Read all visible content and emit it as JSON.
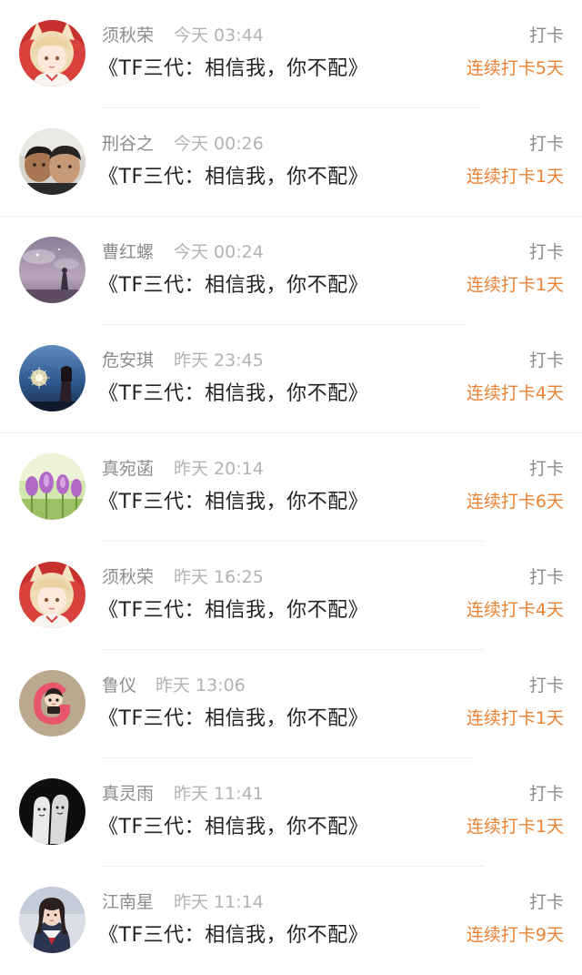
{
  "colors": {
    "name": "#8c8c8c",
    "time": "#b3b3b3",
    "content": "#222222",
    "streak": "#ec8233",
    "divider": "#efefef"
  },
  "items": [
    {
      "name": "须秋荣",
      "time": "今天 03:44",
      "content": "《TF三代：相信我，你不配》",
      "action": "打卡",
      "streak": "连续打卡5天",
      "avatar": "anime-girl-fox-ears-icon"
    },
    {
      "name": "刑谷之",
      "time": "今天 00:26",
      "content": "《TF三代：相信我，你不配》",
      "action": "打卡",
      "streak": "连续打卡1天",
      "avatar": "two-boys-photo-icon"
    },
    {
      "name": "曹红螺",
      "time": "今天 00:24",
      "content": "《TF三代：相信我，你不配》",
      "action": "打卡",
      "streak": "连续打卡1天",
      "avatar": "purple-sky-girl-icon"
    },
    {
      "name": "危安琪",
      "time": "昨天 23:45",
      "content": "《TF三代：相信我，你不配》",
      "action": "打卡",
      "streak": "连续打卡4天",
      "avatar": "sparkler-night-girl-icon"
    },
    {
      "name": "真宛菡",
      "time": "昨天 20:14",
      "content": "《TF三代：相信我，你不配》",
      "action": "打卡",
      "streak": "连续打卡6天",
      "avatar": "purple-flowers-icon"
    },
    {
      "name": "须秋荣",
      "time": "昨天 16:25",
      "content": "《TF三代：相信我，你不配》",
      "action": "打卡",
      "streak": "连续打卡4天",
      "avatar": "anime-girl-fox-ears-icon"
    },
    {
      "name": "鲁仪",
      "time": "昨天 13:06",
      "content": "《TF三代：相信我，你不配》",
      "action": "打卡",
      "streak": "连续打卡1天",
      "avatar": "letter-g-cartoon-icon"
    },
    {
      "name": "真灵雨",
      "time": "昨天 11:41",
      "content": "《TF三代：相信我，你不配》",
      "action": "打卡",
      "streak": "连续打卡1天",
      "avatar": "finger-faces-icon"
    },
    {
      "name": "江南星",
      "time": "昨天 11:14",
      "content": "《TF三代：相信我，你不配》",
      "action": "打卡",
      "streak": "连续打卡9天",
      "avatar": "sailor-uniform-girl-icon"
    }
  ]
}
